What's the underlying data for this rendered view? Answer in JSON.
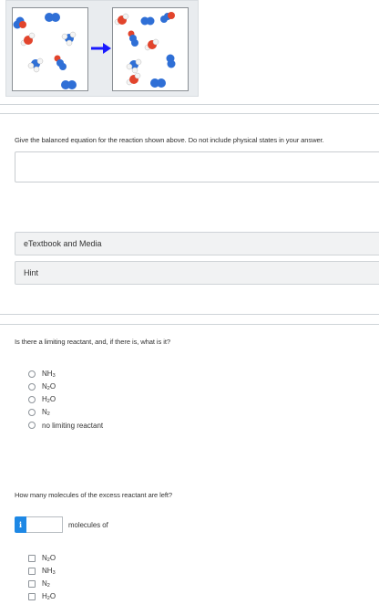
{
  "figure": {
    "colors": {
      "nitrogen": "#2f6fd6",
      "oxygen": "#e2442c",
      "hydrogen": "#f4f4f4",
      "arrow": "#1a1aff"
    },
    "before_label": "",
    "after_label": ""
  },
  "q1": {
    "prompt": "Give the balanced equation for the reaction shown above. Do not include physical states in your answer.",
    "answer_value": ""
  },
  "resources": {
    "etextbook_label": "eTextbook and Media",
    "hint_label": "Hint"
  },
  "q2": {
    "prompt": "Is there a limiting reactant, and, if there is, what is it?",
    "options": [
      {
        "base": "NH",
        "sub": "3",
        "tail": ""
      },
      {
        "base": "N",
        "sub": "2",
        "tail": "O"
      },
      {
        "base": "H",
        "sub": "2",
        "tail": "O"
      },
      {
        "base": "N",
        "sub": "2",
        "tail": ""
      },
      {
        "base": "no limiting reactant",
        "sub": "",
        "tail": ""
      }
    ]
  },
  "q3": {
    "prompt": "How many molecules of the excess reactant are left?",
    "info_glyph": "i",
    "input_value": "",
    "unit_label": "molecules of",
    "options": [
      {
        "base": "N",
        "sub": "2",
        "tail": "O"
      },
      {
        "base": "NH",
        "sub": "3",
        "tail": ""
      },
      {
        "base": "N",
        "sub": "2",
        "tail": ""
      },
      {
        "base": "H",
        "sub": "2",
        "tail": "O"
      }
    ]
  }
}
